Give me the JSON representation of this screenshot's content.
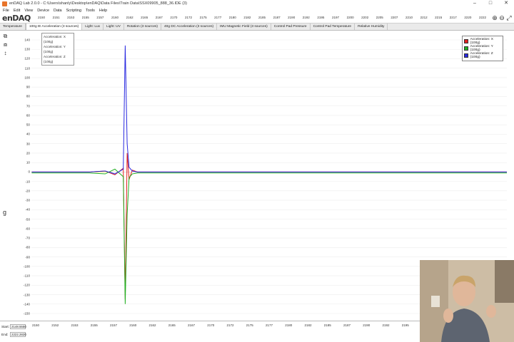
{
  "window": {
    "title": "enDAQ Lab 2.0.0 - C:\\Users\\shanly\\Desktop\\enDAQ\\Data Files\\Train Data\\SSX09905_888_36.IDE (3)",
    "controls": [
      "–",
      "□",
      "✕"
    ]
  },
  "menu": [
    "File",
    "Edit",
    "View",
    "Device",
    "Data",
    "Scripting",
    "Tools",
    "Help"
  ],
  "logo": "enDAQ",
  "top_axis_ticks": [
    "2150",
    "2151",
    "2153",
    "2155",
    "2157",
    "2160",
    "2162",
    "2165",
    "2167",
    "2170",
    "2172",
    "2175",
    "2177",
    "2180",
    "2182",
    "2185",
    "2187",
    "2190",
    "2192",
    "2195",
    "2197",
    "2200",
    "2202",
    "2205",
    "2207",
    "2210",
    "2212",
    "2215",
    "2217",
    "2220",
    "2222"
  ],
  "tabs": [
    {
      "label": "Temperature"
    },
    {
      "label": "100g IE Acceleration (3 sources)"
    },
    {
      "label": "Light: Lux"
    },
    {
      "label": "Light: UV"
    },
    {
      "label": "Rotation (3 sources)"
    },
    {
      "label": "40g DC Acceleration (3 sources)"
    },
    {
      "label": "IMU Magnetic Field (3 sources)"
    },
    {
      "label": "Control Pad Pressure"
    },
    {
      "label": "Control Pad Temperature"
    },
    {
      "label": "Relative Humidity"
    }
  ],
  "active_tab_index": 1,
  "unit_label": "g",
  "cursor_readout": [
    "Acceleration: X (100g)",
    "Acceleration: Y (100g)",
    "Acceleration: Z (100g)"
  ],
  "bottom": {
    "start_label": "Start:",
    "start_value": "2148.5550",
    "end_label": "End:",
    "end_value": "2222.2820"
  },
  "chart_data": {
    "type": "line",
    "x_range": [
      2148.555,
      2222.282
    ],
    "ylim": [
      -150,
      140
    ],
    "y_ticks": [
      140,
      130,
      120,
      110,
      100,
      90,
      80,
      70,
      60,
      50,
      40,
      30,
      20,
      10,
      0,
      -10,
      -20,
      -30,
      -40,
      -50,
      -60,
      -70,
      -80,
      -90,
      -100,
      -110,
      -120,
      -130,
      -140,
      -150
    ],
    "x_ticks": [
      "2150",
      "2152",
      "2153",
      "2155",
      "2157",
      "2160",
      "2162",
      "2165",
      "2167",
      "2170",
      "2172",
      "2175",
      "2177",
      "2180",
      "2182",
      "2185",
      "2187",
      "2190",
      "2192",
      "2195",
      "2197",
      "2200",
      "2202",
      "2205",
      "2207"
    ],
    "grid": true,
    "legend_position": "top-right",
    "series": [
      {
        "name": "Acceleration: X (100g)",
        "color": "#e32020",
        "x": [
          2148.6,
          2157.5,
          2160.0,
          2161.5,
          2162.8,
          2163.1,
          2163.4,
          2163.7,
          2164.2,
          2165.0,
          2222.3
        ],
        "y": [
          0,
          0,
          1,
          -3,
          4,
          -135,
          20,
          -8,
          2,
          0,
          0
        ]
      },
      {
        "name": "Acceleration: Y (100g)",
        "color": "#22b022",
        "x": [
          2148.6,
          2157.5,
          2160.0,
          2161.5,
          2162.8,
          2163.1,
          2163.4,
          2163.7,
          2164.2,
          2165.0,
          2222.3
        ],
        "y": [
          -1,
          -1,
          -2,
          3,
          -5,
          -140,
          -45,
          -6,
          -2,
          -1,
          -1
        ]
      },
      {
        "name": "Acceleration: Z (100g)",
        "color": "#2a2ae0",
        "x": [
          2148.6,
          2157.5,
          2160.0,
          2161.5,
          2162.8,
          2163.1,
          2163.4,
          2163.7,
          2164.2,
          2165.0,
          2222.3
        ],
        "y": [
          0,
          0,
          1,
          -2,
          3,
          134,
          30,
          5,
          1,
          0,
          0
        ]
      }
    ]
  }
}
